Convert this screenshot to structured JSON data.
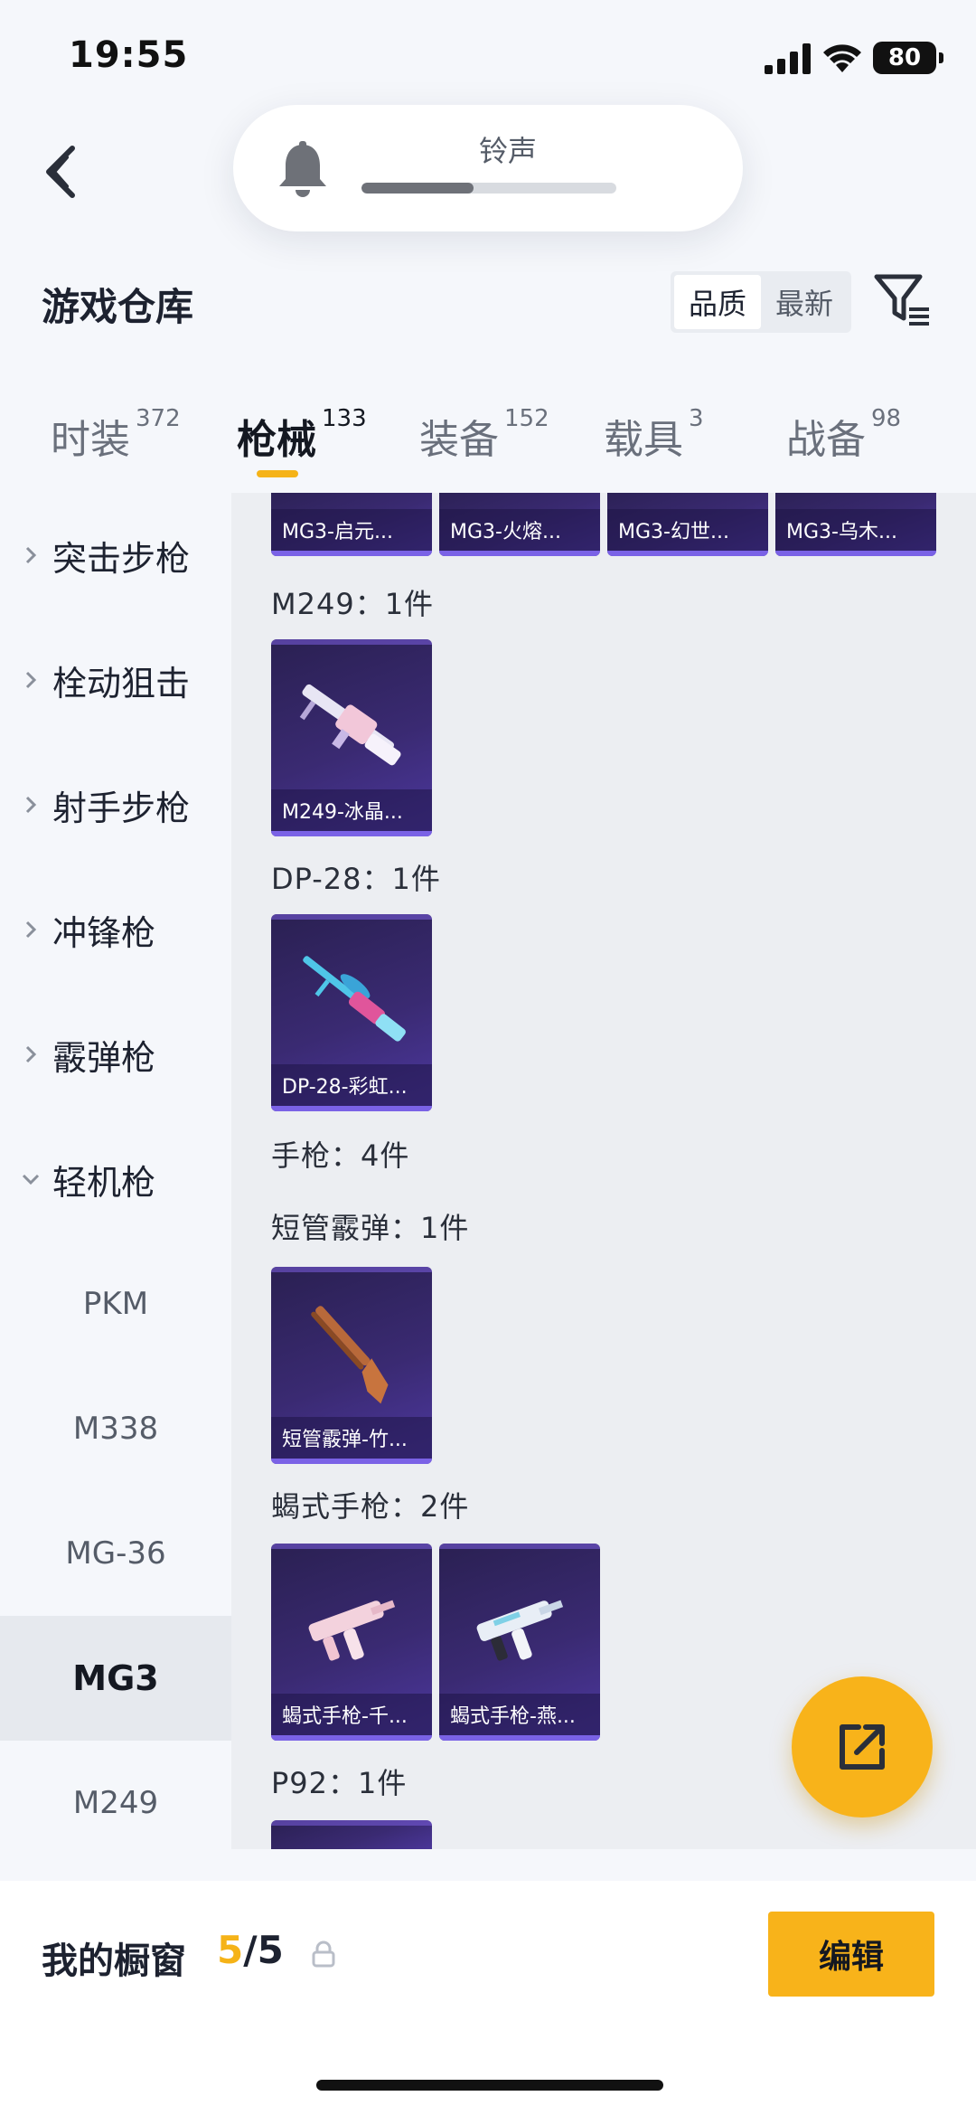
{
  "status": {
    "time": "19:55",
    "battery": "80"
  },
  "header": {
    "ringtone_label": "铃声",
    "ringtone_level": 0.44,
    "title": "游戏仓库",
    "sort_options": [
      "品质",
      "最新"
    ],
    "sort_active": "品质"
  },
  "tabs": [
    {
      "label": "时装",
      "count": "372"
    },
    {
      "label": "枪械",
      "count": "133",
      "active": true
    },
    {
      "label": "装备",
      "count": "152"
    },
    {
      "label": "载具",
      "count": "3"
    },
    {
      "label": "战备",
      "count": "98"
    }
  ],
  "sidebar": {
    "categories": [
      {
        "label": "突击步枪",
        "expanded": false
      },
      {
        "label": "栓动狙击",
        "expanded": false
      },
      {
        "label": "射手步枪",
        "expanded": false
      },
      {
        "label": "冲锋枪",
        "expanded": false
      },
      {
        "label": "霰弹枪",
        "expanded": false
      },
      {
        "label": "轻机枪",
        "expanded": true
      }
    ],
    "subitems": [
      {
        "label": "PKM"
      },
      {
        "label": "M338"
      },
      {
        "label": "MG-36"
      },
      {
        "label": "MG3",
        "active": true
      },
      {
        "label": "M249"
      }
    ]
  },
  "content": {
    "top_row": [
      "MG3-启元...",
      "MG3-火熔...",
      "MG3-幻世...",
      "MG3-乌木..."
    ],
    "groups": [
      {
        "title": "M249：1件",
        "items": [
          "M249-冰晶..."
        ]
      },
      {
        "title": "DP-28：1件",
        "items": [
          "DP-28-彩虹..."
        ]
      },
      {
        "title": "手枪：4件",
        "items": []
      },
      {
        "title": "短管霰弹：1件",
        "items": [
          "短管霰弹-竹..."
        ]
      },
      {
        "title": "蝎式手枪：2件",
        "items": [
          "蝎式手枪-千...",
          "蝎式手枪-燕..."
        ]
      },
      {
        "title": "P92：1件",
        "items": []
      }
    ]
  },
  "bottom": {
    "label": "我的橱窗",
    "current": "5",
    "separator": "/",
    "max": "5",
    "edit_label": "编辑"
  },
  "colors": {
    "accent": "#f8b31a",
    "card": "#3a2a72"
  }
}
